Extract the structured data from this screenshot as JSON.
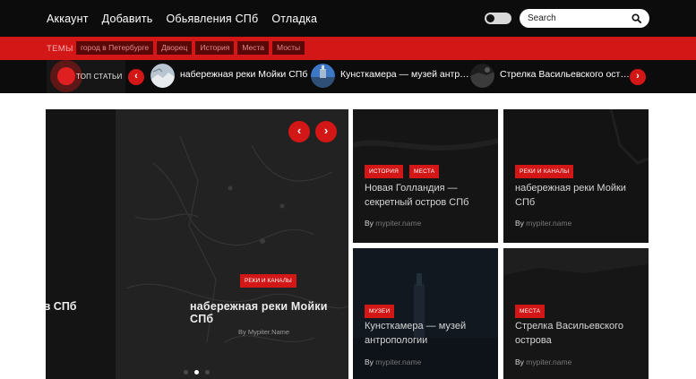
{
  "nav": {
    "items": [
      "Аккаунт",
      "Добавить",
      "Обьявления СПб",
      "Отладка"
    ]
  },
  "search": {
    "placeholder": "Search"
  },
  "topics": {
    "label": "ТЕМЫ",
    "tags": [
      "город в Петербурге",
      "Дворец",
      "История",
      "Места",
      "Мосты"
    ]
  },
  "ticker": {
    "label": "ТОП СТАТЬИ",
    "items": [
      {
        "title": "набережная реки Мойки СПб"
      },
      {
        "title": "Кунсткамера — музей антропологии"
      },
      {
        "title": "Стрелка Васильевского острова"
      }
    ]
  },
  "slider": {
    "category": "РЕКИ И КАНАЛЫ",
    "title": "набережная реки Мойки СПб",
    "prev_title_fragment": "ов СПб",
    "byline": "By Mypiter.Name",
    "active_dot": 2,
    "dot_count": 3
  },
  "cards": [
    {
      "badges": [
        "ИСТОРИЯ",
        "МЕСТА"
      ],
      "title": "Новая Голландия — секретный остров СПб",
      "by": "By",
      "author": "mypiter.name"
    },
    {
      "badges": [
        "РЕКИ И КАНАЛЫ"
      ],
      "title": "набережная реки Мойки СПб",
      "by": "By",
      "author": "mypiter.name"
    },
    {
      "badges": [
        "МУЗЕИ"
      ],
      "title": "Кунсткамера — музей антропологии",
      "by": "By",
      "author": "mypiter.name"
    },
    {
      "badges": [
        "МЕСТА"
      ],
      "title": "Стрелка Васильевского острова",
      "by": "By",
      "author": "mypiter.name"
    }
  ],
  "colors": {
    "accent": "#d31616",
    "dark": "#0c0c0c"
  },
  "icons": {
    "search": "search-icon",
    "prev": "chevron-left-icon",
    "next": "chevron-right-icon"
  }
}
